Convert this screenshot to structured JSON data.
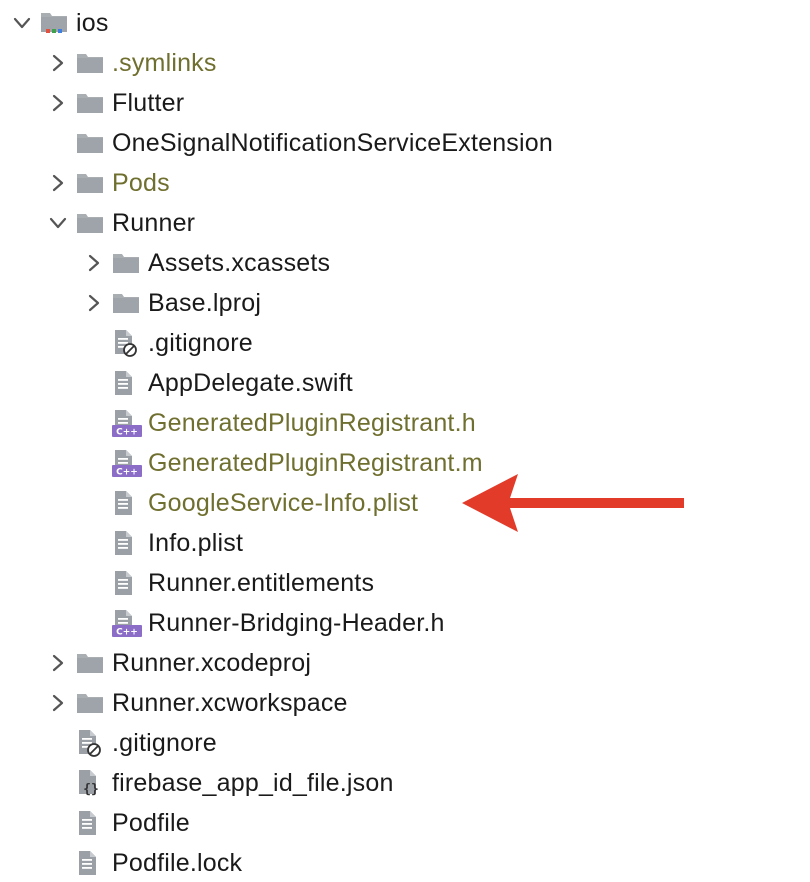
{
  "colors": {
    "olive_text": "#6f6f2f",
    "default_text": "#1a1a1a",
    "folder": "#a9aeb3",
    "file": "#9aa0a6",
    "cpp_badge": "#8b6cc7",
    "arrow": "#e23b2a"
  },
  "tree": [
    {
      "label": "ios",
      "depth": 0,
      "kind": "folder-root",
      "expand": "expanded",
      "highlight": false
    },
    {
      "label": ".symlinks",
      "depth": 1,
      "kind": "folder",
      "expand": "collapsed",
      "highlight": true
    },
    {
      "label": "Flutter",
      "depth": 1,
      "kind": "folder",
      "expand": "collapsed",
      "highlight": false
    },
    {
      "label": "OneSignalNotificationServiceExtension",
      "depth": 1,
      "kind": "folder",
      "expand": "none",
      "highlight": false
    },
    {
      "label": "Pods",
      "depth": 1,
      "kind": "folder",
      "expand": "collapsed",
      "highlight": true
    },
    {
      "label": "Runner",
      "depth": 1,
      "kind": "folder",
      "expand": "expanded",
      "highlight": false
    },
    {
      "label": "Assets.xcassets",
      "depth": 2,
      "kind": "folder",
      "expand": "collapsed",
      "highlight": false
    },
    {
      "label": "Base.lproj",
      "depth": 2,
      "kind": "folder",
      "expand": "collapsed",
      "highlight": false
    },
    {
      "label": ".gitignore",
      "depth": 2,
      "kind": "gitignore",
      "expand": "none",
      "highlight": false
    },
    {
      "label": "AppDelegate.swift",
      "depth": 2,
      "kind": "text",
      "expand": "none",
      "highlight": false
    },
    {
      "label": "GeneratedPluginRegistrant.h",
      "depth": 2,
      "kind": "cpp",
      "expand": "none",
      "highlight": true
    },
    {
      "label": "GeneratedPluginRegistrant.m",
      "depth": 2,
      "kind": "cpp",
      "expand": "none",
      "highlight": true
    },
    {
      "label": "GoogleService-Info.plist",
      "depth": 2,
      "kind": "text",
      "expand": "none",
      "highlight": true
    },
    {
      "label": "Info.plist",
      "depth": 2,
      "kind": "text",
      "expand": "none",
      "highlight": false
    },
    {
      "label": "Runner.entitlements",
      "depth": 2,
      "kind": "text",
      "expand": "none",
      "highlight": false
    },
    {
      "label": "Runner-Bridging-Header.h",
      "depth": 2,
      "kind": "cpp",
      "expand": "none",
      "highlight": false
    },
    {
      "label": "Runner.xcodeproj",
      "depth": 1,
      "kind": "folder",
      "expand": "collapsed",
      "highlight": false
    },
    {
      "label": "Runner.xcworkspace",
      "depth": 1,
      "kind": "folder",
      "expand": "collapsed",
      "highlight": false
    },
    {
      "label": ".gitignore",
      "depth": 1,
      "kind": "gitignore",
      "expand": "none",
      "highlight": false
    },
    {
      "label": "firebase_app_id_file.json",
      "depth": 1,
      "kind": "json",
      "expand": "none",
      "highlight": false
    },
    {
      "label": "Podfile",
      "depth": 1,
      "kind": "text",
      "expand": "none",
      "highlight": false
    },
    {
      "label": "Podfile.lock",
      "depth": 1,
      "kind": "text",
      "expand": "none",
      "highlight": false
    }
  ],
  "annotation": {
    "points_to": "GoogleService-Info.plist",
    "icon": "red-arrow-icon"
  }
}
